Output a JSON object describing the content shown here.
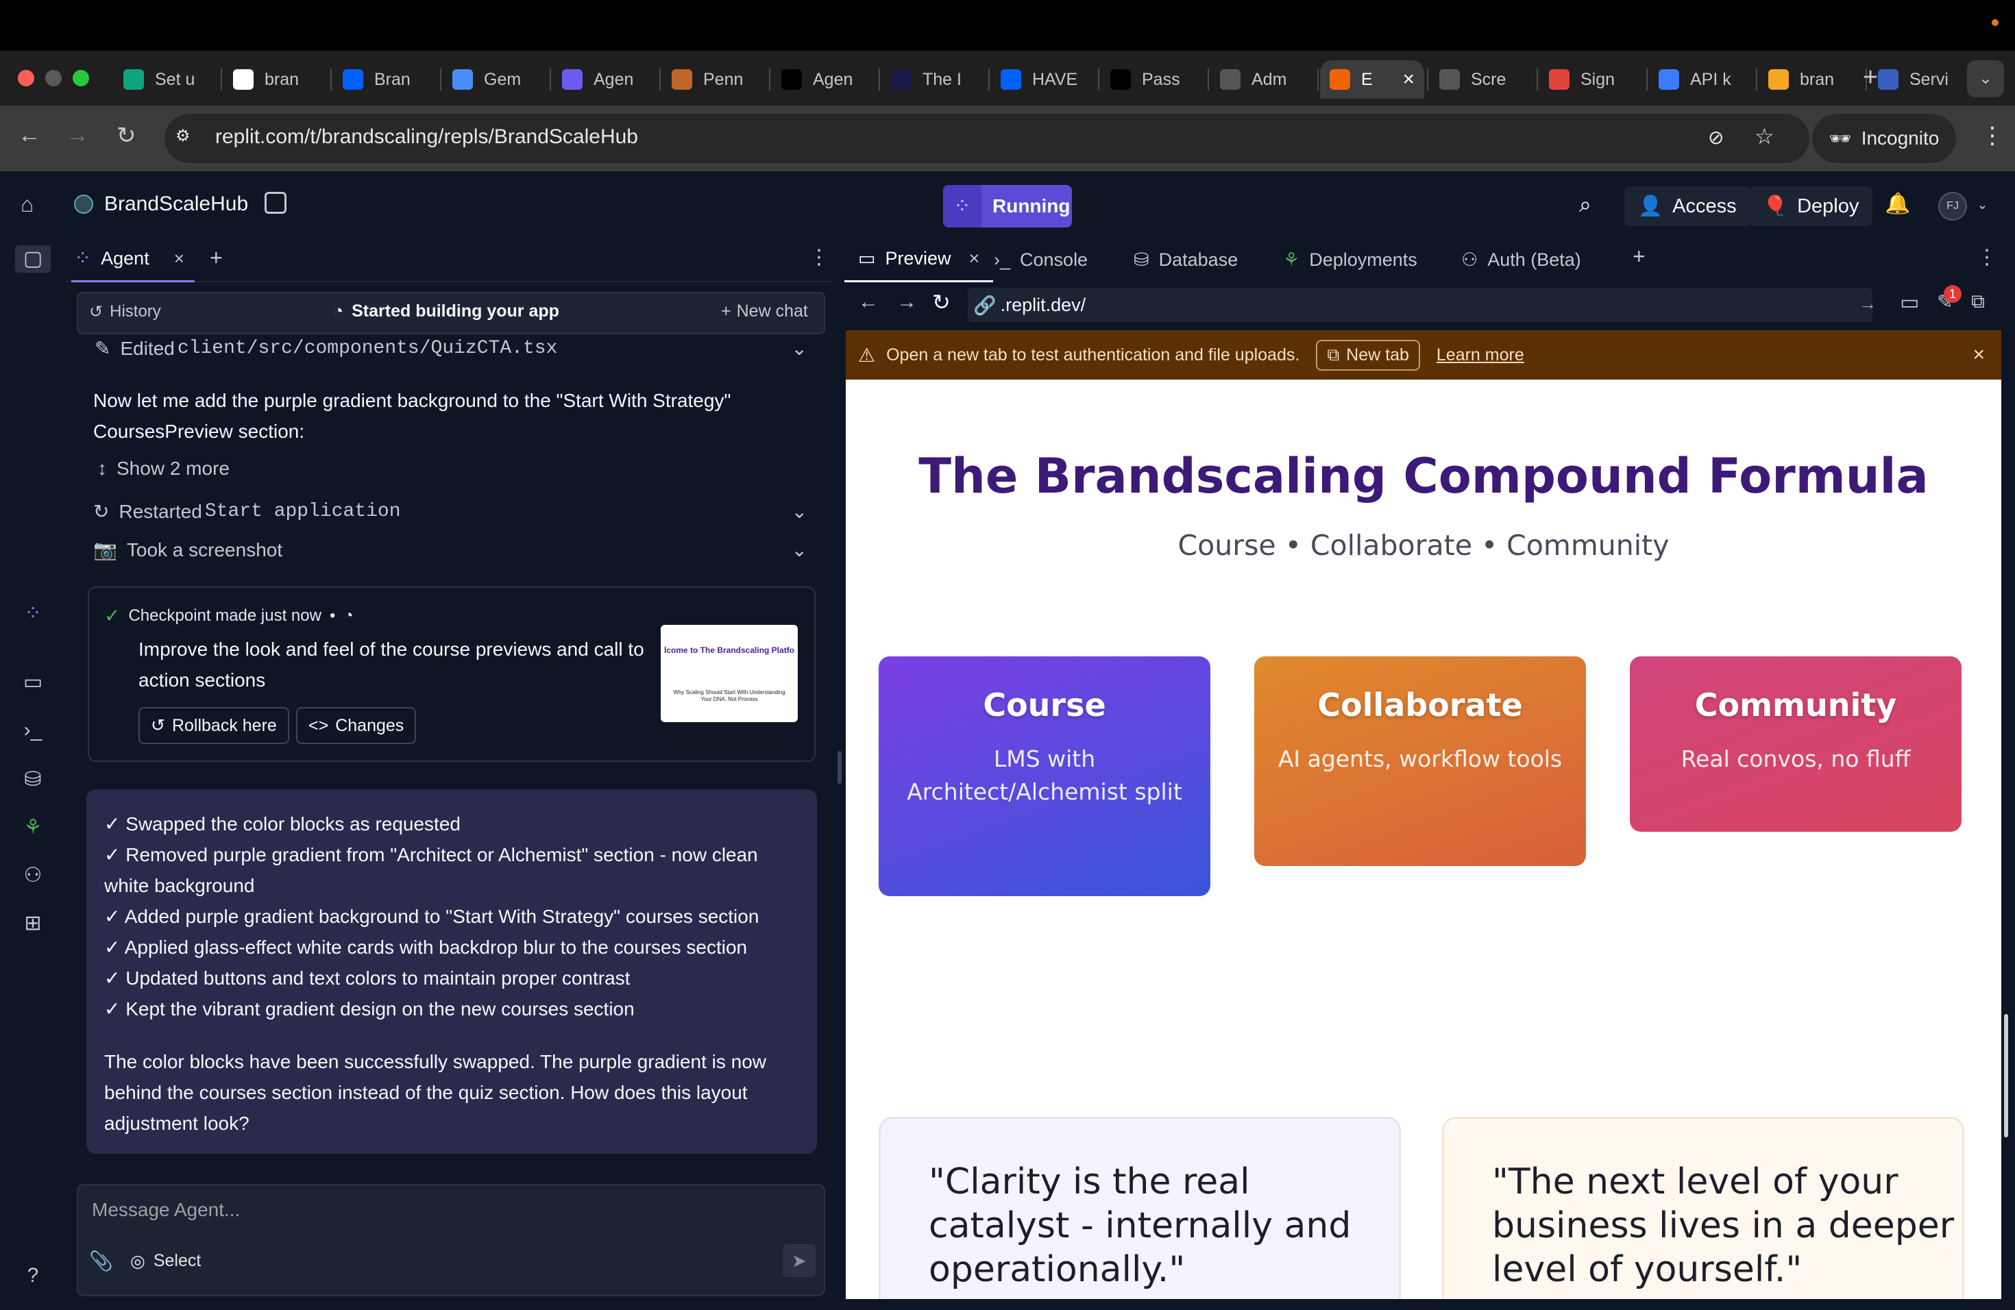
{
  "browser": {
    "tabs": [
      {
        "label": "Set u",
        "icon": "chatgpt-icon"
      },
      {
        "label": "bran",
        "icon": "doc-icon"
      },
      {
        "label": "Bran",
        "icon": "dropbox-icon"
      },
      {
        "label": "Gem",
        "icon": "gemini-icon"
      },
      {
        "label": "Agen",
        "icon": "agent-icon"
      },
      {
        "label": "Penn",
        "icon": "pennant-icon"
      },
      {
        "label": "Agen",
        "icon": "triangle-icon"
      },
      {
        "label": "The I",
        "icon": "moon-icon"
      },
      {
        "label": "HAVE",
        "icon": "dropbox-icon"
      },
      {
        "label": "Pass",
        "icon": "upwork-icon"
      },
      {
        "label": "Adm",
        "icon": "globe-icon"
      },
      {
        "label": "E",
        "icon": "replit-icon"
      },
      {
        "label": "Scre",
        "icon": "globe-icon"
      },
      {
        "label": "Sign",
        "icon": "sign-icon"
      },
      {
        "label": "API k",
        "icon": "openai-icon"
      },
      {
        "label": "bran",
        "icon": "fire-icon"
      },
      {
        "label": "Servi",
        "icon": "shield-icon"
      }
    ],
    "url": "replit.com/t/brandscaling/repls/BrandScaleHub",
    "incognito_label": "Incognito"
  },
  "app": {
    "project_name": "BrandScaleHub",
    "run_label": "Running",
    "access_label": "Access",
    "deploy_label": "Deploy",
    "avatar_initials": "FJ"
  },
  "agent": {
    "tab_label": "Agent",
    "history_label": "History",
    "status_label": "Started building your app",
    "new_chat_label": "New chat",
    "edited_prefix": "Edited ",
    "edited_file": "client/src/components/QuizCTA.tsx",
    "message_1": "Now let me add the purple gradient background to the \"Start With Strategy\" CoursesPreview section:",
    "show_more": "Show 2 more",
    "restarted_prefix": "Restarted ",
    "restarted_target": "Start application",
    "screenshot_label": "Took a screenshot",
    "checkpoint": {
      "title": "Checkpoint made just now",
      "bullet": "•",
      "description": "Improve the look and feel of the course previews and call to action sections",
      "thumb_title": "lcome to The Brandscaling Platfo",
      "thumb_sub": "Why Scaling Should Start With Understanding Your DNA, Not Process",
      "rollback_label": "Rollback here",
      "changes_label": "Changes"
    },
    "summary_items": [
      "✓ Swapped the color blocks as requested",
      "✓ Removed purple gradient from \"Architect or Alchemist\" section - now clean white background",
      "✓ Added purple gradient background to \"Start With Strategy\" courses section",
      "✓ Applied glass-effect white cards with backdrop blur to the courses section",
      "✓ Updated buttons and text colors to maintain proper contrast",
      "✓ Kept the vibrant gradient design on the new courses section"
    ],
    "summary_closing": "The color blocks have been successfully swapped. The purple gradient is now behind the courses section instead of the quiz section. How does this layout adjustment look?",
    "input_placeholder": "Message Agent...",
    "select_label": "Select"
  },
  "workspace": {
    "tabs": [
      "Preview",
      "Console",
      "Database",
      "Deployments",
      "Auth (Beta)"
    ],
    "preview_url": ".replit.dev/",
    "banner_text": "Open a new tab to test authentication and file uploads.",
    "banner_button": "New tab",
    "banner_link": "Learn more",
    "notification_count": "1"
  },
  "page": {
    "headline": "The Brandscaling Compound Formula",
    "subheadline": "Course • Collaborate • Community",
    "cards": [
      {
        "title": "Course",
        "text": "LMS with Architect/Alchemist split",
        "color_start": "#7b3fe4",
        "color_end": "#3a55d9"
      },
      {
        "title": "Collaborate",
        "text": "AI agents, workflow tools",
        "color_start": "#e08a2d",
        "color_end": "#d8603a"
      },
      {
        "title": "Community",
        "text": "Real convos, no fluff",
        "color_start": "#d0457c",
        "color_end": "#d84560"
      }
    ],
    "quotes": [
      "\"Clarity is the real catalyst - internally and operationally.\"",
      "\"The next level of your business lives in a deeper level of yourself.\""
    ],
    "headline_color": "#3d1a78"
  },
  "footer": {
    "help_label": "?"
  }
}
